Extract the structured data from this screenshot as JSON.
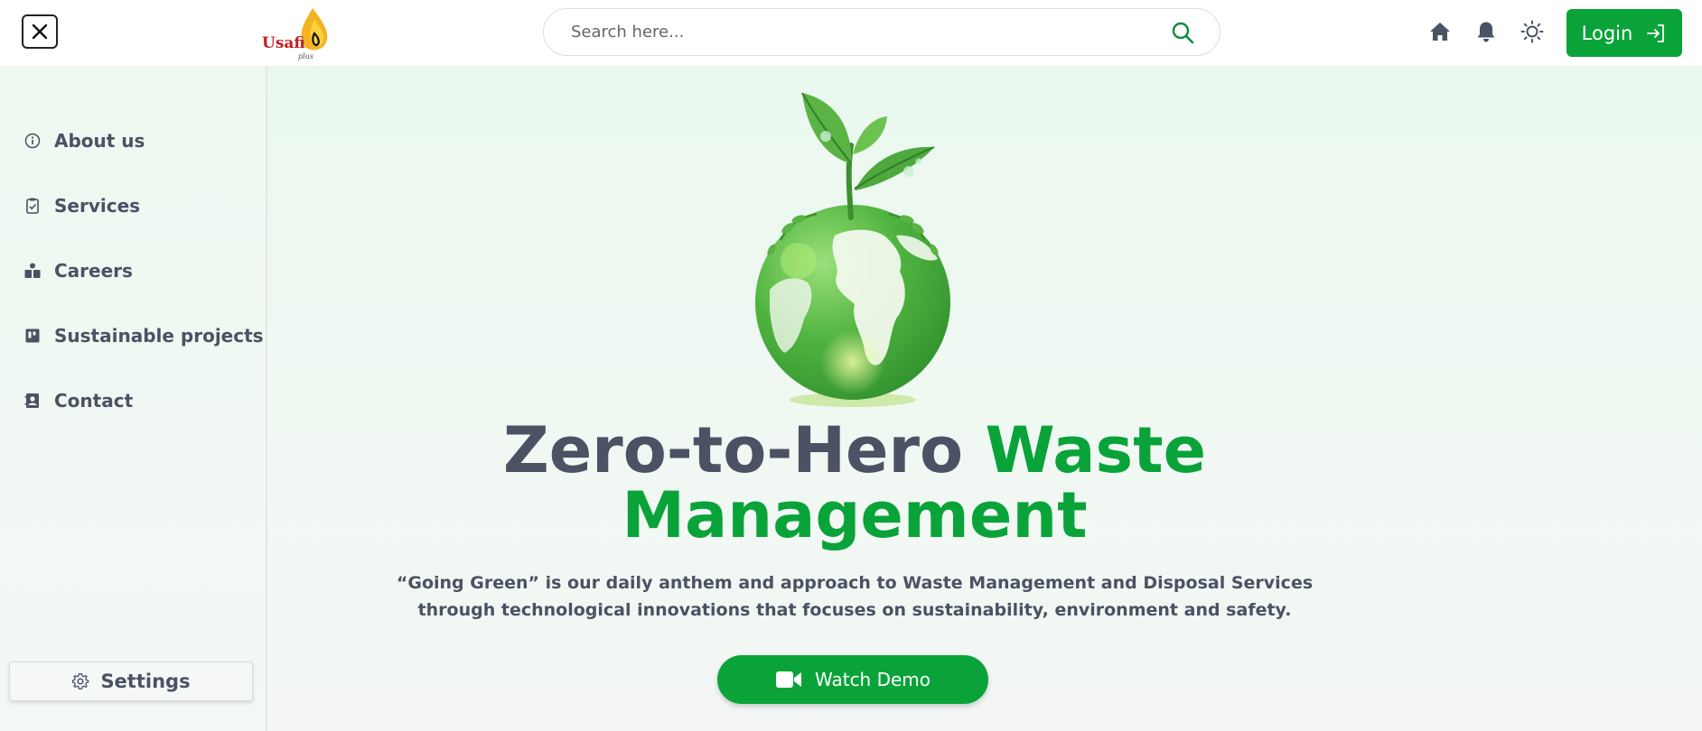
{
  "header": {
    "logo_text": "Usafi",
    "logo_sub": "plus",
    "search": {
      "placeholder": "Search here..."
    },
    "login_label": "Login"
  },
  "icons": {
    "close": "close-icon",
    "search": "search-icon",
    "home": "home-icon",
    "notifications": "bell-icon",
    "theme": "sun-icon",
    "login": "login-arrow-icon",
    "settings": "gear-icon",
    "video": "video-camera-icon"
  },
  "sidebar": {
    "items": [
      {
        "label": "About us",
        "icon": "info-icon"
      },
      {
        "label": "Services",
        "icon": "clipboard-check-icon"
      },
      {
        "label": "Careers",
        "icon": "briefcase-user-icon"
      },
      {
        "label": "Sustainable projects",
        "icon": "board-icon"
      },
      {
        "label": "Contact",
        "icon": "contact-card-icon"
      }
    ],
    "settings_label": "Settings"
  },
  "hero": {
    "title_part1": "Zero-to-Hero ",
    "title_part2": "Waste Management",
    "description": "“Going Green” is our daily anthem and approach to Waste Management and Disposal Services through technological innovations that focuses on sustainability, environment and safety.",
    "cta_label": "Watch Demo",
    "image": "green-globe-with-plant"
  },
  "colors": {
    "accent": "#0aa33a",
    "text": "#4a5263",
    "sidebar_bg": "#eef9f1"
  }
}
